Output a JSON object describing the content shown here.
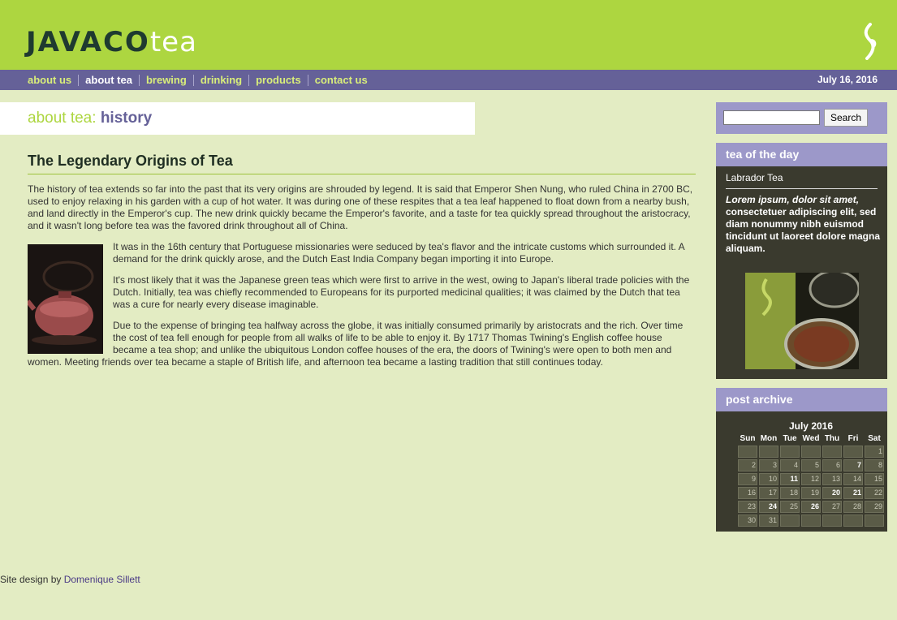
{
  "brand": {
    "name_part1": "JAVACO",
    "name_part2": "tea"
  },
  "nav": {
    "items": [
      {
        "label": "about us",
        "active": false
      },
      {
        "label": "about tea",
        "active": true
      },
      {
        "label": "brewing",
        "active": false
      },
      {
        "label": "drinking",
        "active": false
      },
      {
        "label": "products",
        "active": false
      },
      {
        "label": "contact us",
        "active": false
      }
    ],
    "date": "July 16, 2016"
  },
  "page_title": {
    "section": "about tea:",
    "subsection": "history"
  },
  "article": {
    "heading": "The Legendary Origins of Tea",
    "paragraphs": [
      "The history of tea extends so far into the past that its very origins are shrouded by legend. It is said that Emperor Shen Nung, who ruled China in 2700 BC, used to enjoy relaxing in his garden with a cup of hot water. It was during one of these respites that a tea leaf happened to float down from a nearby bush, and land directly in the Emperor's cup. The new drink quickly became the Emperor's favorite, and a taste for tea quickly spread throughout the aristocracy, and it wasn't long before tea was the favored drink throughout all of China.",
      "It was in the 16th century that Portuguese missionaries were seduced by tea's flavor and the intricate customs which surrounded it. A demand for the drink quickly arose, and the Dutch East India Company began importing it into Europe.",
      "It's most likely that it was the Japanese green teas which were first to arrive in the west, owing to Japan's liberal trade policies with the Dutch. Initially, tea was chiefly recommended to Europeans for its purported medicinal qualities; it was claimed by the Dutch that tea was a cure for nearly every disease imaginable.",
      "Due to the expense of bringing tea halfway across the globe, it was initially consumed primarily by aristocrats and the rich. Over time the cost of tea fell enough for people from all walks of life to be able to enjoy it. By 1717 Thomas Twining's English coffee house became a tea shop; and unlike the ubiquitous London coffee houses of the era, the doors of Twining's were open to both men and women. Meeting friends over tea became a staple of British life, and afternoon tea became a lasting tradition that still continues today."
    ]
  },
  "search": {
    "placeholder": "",
    "button_label": "Search"
  },
  "tea_of_the_day": {
    "heading": "tea of the day",
    "name": "Labrador Tea",
    "desc_italic": "Lorem ipsum, dolor sit amet,",
    "desc_rest": " consectetuer adipiscing elit, sed diam nonummy nibh euismod tincidunt ut laoreet dolore magna aliquam."
  },
  "archive": {
    "heading": "post archive",
    "calendar": {
      "caption": "July 2016",
      "weekdays": [
        "Sun",
        "Mon",
        "Tue",
        "Wed",
        "Thu",
        "Fri",
        "Sat"
      ],
      "weeks": [
        [
          "",
          "",
          "",
          "",
          "",
          "",
          "1"
        ],
        [
          "2",
          "3",
          "4",
          "5",
          "6",
          "7",
          "8"
        ],
        [
          "9",
          "10",
          "11",
          "12",
          "13",
          "14",
          "15"
        ],
        [
          "16",
          "17",
          "18",
          "19",
          "20",
          "21",
          "22"
        ],
        [
          "23",
          "24",
          "25",
          "26",
          "27",
          "28",
          "29"
        ],
        [
          "30",
          "31",
          "",
          "",
          "",
          "",
          ""
        ]
      ],
      "linked_days": [
        "7",
        "11",
        "20",
        "21",
        "24",
        "26"
      ]
    }
  },
  "footer": {
    "text": "Site design by ",
    "link": "Domenique Sillett"
  }
}
